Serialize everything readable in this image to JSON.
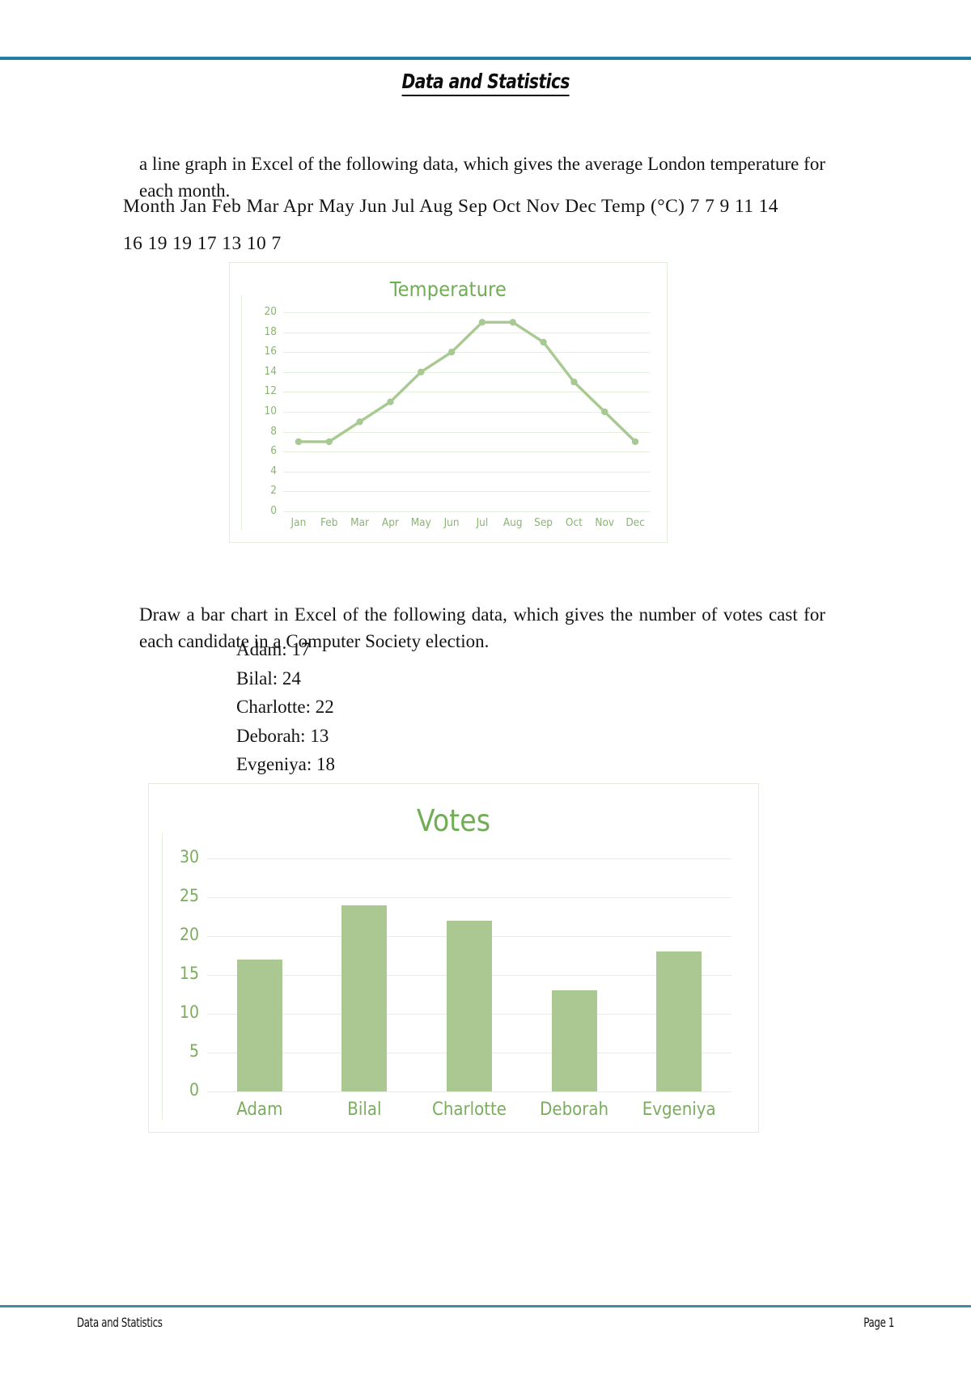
{
  "document": {
    "title": "Data and Statistics",
    "footer_left": "Data and Statistics",
    "footer_right": "Page 1",
    "accent_rule_color": "#1f7a9c"
  },
  "body": {
    "intro_paragraph": "a line graph in Excel of the following data, which gives the average London temperature for each month.",
    "data_table_line1": "Month  Jan  Feb  Mar  Apr  May  Jun  Jul  Aug  Sep  Oct  Nov  Dec  Temp (°C)  7  7  9  11  14",
    "data_table_line2": "16  19  19  17  13  10  7",
    "bar_paragraph": "Draw a bar chart in Excel of the following data, which gives the number of votes cast for each candidate in a Computer Society election.",
    "candidates": [
      "Adam: 17",
      "Bilal: 24",
      "Charlotte: 22",
      "Deborah: 13",
      "Evgeniya: 18"
    ]
  },
  "chart_data": [
    {
      "type": "line",
      "title": "Temperature",
      "categories": [
        "Jan",
        "Feb",
        "Mar",
        "Apr",
        "May",
        "Jun",
        "Jul",
        "Aug",
        "Sep",
        "Oct",
        "Nov",
        "Dec"
      ],
      "values": [
        7,
        7,
        9,
        11,
        14,
        16,
        19,
        19,
        17,
        13,
        10,
        7
      ],
      "xlabel": "",
      "ylabel": "",
      "ylim": [
        0,
        20
      ],
      "yticks": [
        20,
        18,
        16,
        14,
        12,
        10,
        8,
        6,
        4,
        2,
        0
      ],
      "grid": true,
      "legend": "none",
      "series_color": "#a9c992",
      "marker": "circle",
      "title_color": "#70ad56",
      "tick_color": "#8ab473"
    },
    {
      "type": "bar",
      "title": "Votes",
      "categories": [
        "Adam",
        "Bilal",
        "Charlotte",
        "Deborah",
        "Evgeniya"
      ],
      "values": [
        17,
        24,
        22,
        13,
        18
      ],
      "xlabel": "",
      "ylabel": "",
      "ylim": [
        0,
        30
      ],
      "yticks": [
        30,
        25,
        20,
        15,
        10,
        5,
        0
      ],
      "grid": true,
      "legend": "none",
      "series_color": "#abc893",
      "title_color": "#70ad56",
      "tick_color": "#7aad5e"
    }
  ]
}
